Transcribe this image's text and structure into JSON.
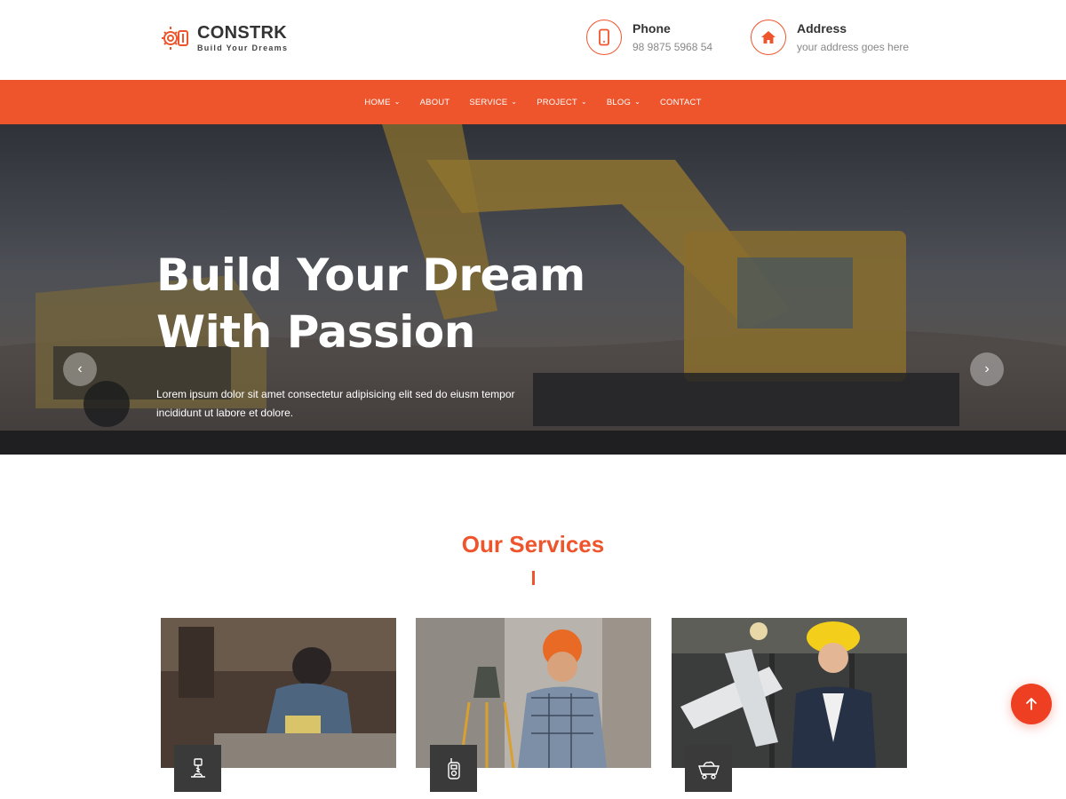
{
  "brand": {
    "name": "CONSTRK",
    "tagline": "Build Your Dreams",
    "accent_color": "#ee552c"
  },
  "contacts": {
    "phone": {
      "label": "Phone",
      "value": "98 9875 5968 54",
      "icon": "phone-icon"
    },
    "address": {
      "label": "Address",
      "value": "your address goes here",
      "icon": "home-icon"
    }
  },
  "nav": {
    "items": [
      {
        "label": "HOME",
        "has_dropdown": true
      },
      {
        "label": "ABOUT",
        "has_dropdown": false
      },
      {
        "label": "SERVICE",
        "has_dropdown": true
      },
      {
        "label": "PROJECT",
        "has_dropdown": true
      },
      {
        "label": "BLOG",
        "has_dropdown": true
      },
      {
        "label": "CONTACT",
        "has_dropdown": false
      }
    ],
    "chevron": "⌄"
  },
  "hero": {
    "title_line1": "Build Your Dream",
    "title_line2": "With Passion",
    "description": "Lorem ipsum dolor sit amet consectetur adipisicing elit sed do eiusm tempor incididunt ut labore et dolore.",
    "prev_arrow": "‹",
    "next_arrow": "›"
  },
  "services": {
    "title": "Our Services",
    "cards": [
      {
        "image": "worker-welding-photo",
        "icon": "drill-icon"
      },
      {
        "image": "surveyor-engineer-photo",
        "icon": "walkie-talkie-icon"
      },
      {
        "image": "architect-blueprints-photo",
        "icon": "mine-cart-icon"
      }
    ]
  },
  "scroll_top": {
    "icon": "arrow-up-icon"
  }
}
